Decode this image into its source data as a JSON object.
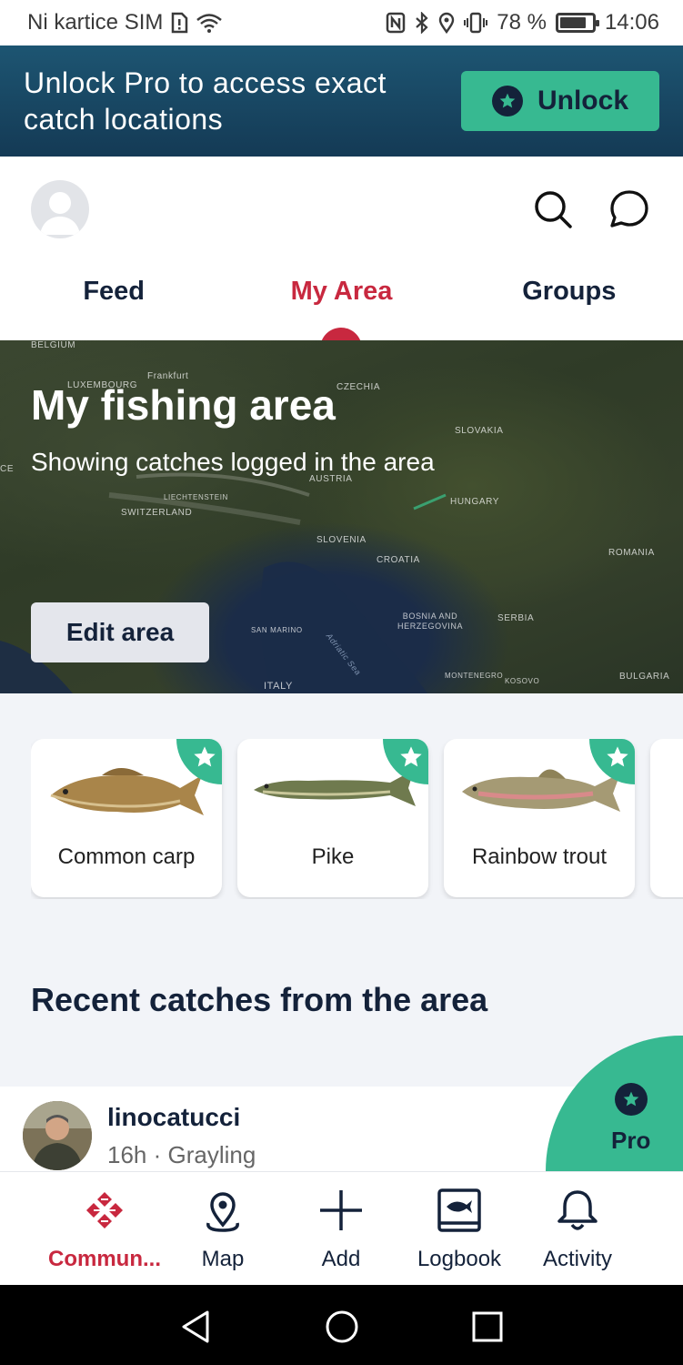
{
  "status_bar": {
    "carrier": "Ni kartice SIM",
    "battery_percent": "78 %",
    "battery_level": 0.78,
    "time": "14:06"
  },
  "pro_banner": {
    "text": "Unlock Pro to access exact catch locations",
    "button_label": "Unlock"
  },
  "header": {
    "tabs": [
      {
        "label": "Feed",
        "active": false
      },
      {
        "label": "My Area",
        "active": true
      },
      {
        "label": "Groups",
        "active": false
      }
    ]
  },
  "map": {
    "title": "My fishing area",
    "subtitle": "Showing catches logged in the area",
    "edit_button": "Edit area",
    "place_labels": {
      "belgium": "BELGIUM",
      "luxembourg": "LUXEMBOURG",
      "frankfurt": "Frankfurt",
      "czechia": "CZECHIA",
      "slovakia": "SLOVAKIA",
      "austria": "AUSTRIA",
      "liechtenstein": "LIECHTENSTEIN",
      "switzerland": "SWITZERLAND",
      "hungary": "HUNGARY",
      "slovenia": "SLOVENIA",
      "croatia": "CROATIA",
      "romania": "ROMANIA",
      "bosnia": "BOSNIA AND HERZEGOVINA",
      "serbia": "SERBIA",
      "san_marino": "SAN MARINO",
      "adriatic": "Adriatic Sea",
      "montenegro": "MONTENEGRO",
      "kosovo": "KOSOVO",
      "bulgaria": "BULGARIA",
      "italy": "ITALY",
      "france_edge": "CE"
    }
  },
  "species": [
    {
      "name": "Common carp",
      "pro": true
    },
    {
      "name": "Pike",
      "pro": true
    },
    {
      "name": "Rainbow trout",
      "pro": true
    }
  ],
  "recent": {
    "title": "Recent catches from the area",
    "post": {
      "username": "linocatucci",
      "meta": "16h · Grayling"
    }
  },
  "pro_fab": {
    "label": "Pro"
  },
  "bottom_nav": [
    {
      "label": "Commun...",
      "icon": "community-icon",
      "active": true
    },
    {
      "label": "Map",
      "icon": "map-pin-icon",
      "active": false
    },
    {
      "label": "Add",
      "icon": "plus-icon",
      "active": false
    },
    {
      "label": "Logbook",
      "icon": "logbook-icon",
      "active": false
    },
    {
      "label": "Activity",
      "icon": "bell-icon",
      "active": false
    }
  ],
  "colors": {
    "accent": "#c8283f",
    "pro_green": "#37b991",
    "navy": "#14223a",
    "banner": "#1d5572"
  }
}
